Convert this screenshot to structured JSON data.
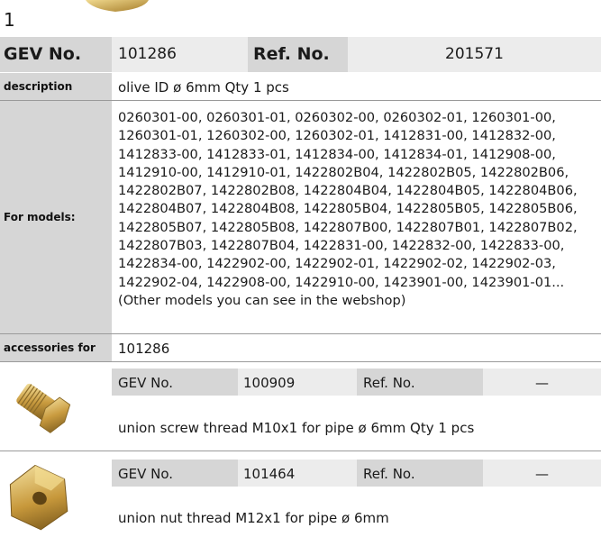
{
  "page_number": "1",
  "main": {
    "gev_label": "GEV No.",
    "gev_value": "101286",
    "ref_label": "Ref. No.",
    "ref_value": "201571",
    "description_label": "description",
    "description_value": "olive  ID ø 6mm Qty 1 pcs",
    "models_label": "For models:",
    "models_lines": [
      "0260301-00, 0260301-01, 0260302-00, 0260302-01, 1260301-00,",
      "1260301-01, 1260302-00, 1260302-01, 1412831-00, 1412832-00,",
      "1412833-00, 1412833-01, 1412834-00, 1412834-01, 1412908-00,",
      "1412910-00, 1412910-01, 1422802B04, 1422802B05, 1422802B06,",
      "1422802B07, 1422802B08, 1422804B04, 1422804B05, 1422804B06,",
      "1422804B07, 1422804B08, 1422805B04, 1422805B05, 1422805B06,",
      "1422805B07, 1422805B08, 1422807B00, 1422807B01, 1422807B02,",
      "1422807B03, 1422807B04, 1422831-00, 1422832-00, 1422833-00,",
      "1422834-00, 1422902-00, 1422902-01, 1422902-02, 1422902-03,",
      "1422902-04, 1422908-00, 1422910-00, 1423901-00, 1423901-01...",
      "(Other models you can see in the webshop)"
    ],
    "accessories_label": "accessories for",
    "accessories_value": "101286"
  },
  "accessories": [
    {
      "gev_label": "GEV No.",
      "gev_value": "100909",
      "ref_label": "Ref. No.",
      "ref_value": "—",
      "description": "union screw  thread M10x1 for pipe ø 6mm Qty 1 pcs",
      "icon": "brass-union-screw-icon"
    },
    {
      "gev_label": "GEV No.",
      "gev_value": "101464",
      "ref_label": "Ref. No.",
      "ref_value": "—",
      "description": "union nut  thread M12x1 for pipe ø 6mm",
      "icon": "brass-union-nut-icon"
    }
  ],
  "colors": {
    "header_gray": "#d6d6d6",
    "light_gray": "#ececec",
    "brass": "#c9a24a"
  }
}
